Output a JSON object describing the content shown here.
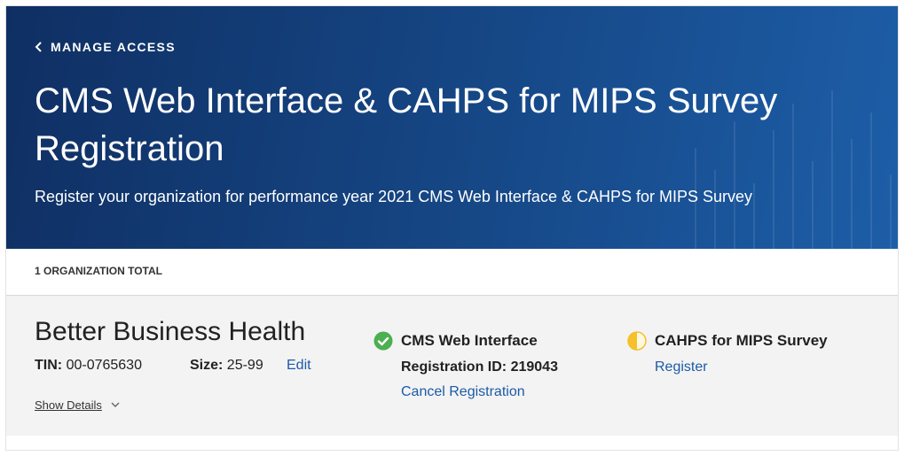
{
  "header": {
    "back_label": "MANAGE ACCESS",
    "title": "CMS Web Interface & CAHPS for MIPS Survey Registration",
    "subtitle": "Register your organization for performance year 2021 CMS Web Interface & CAHPS for MIPS Survey"
  },
  "summary": {
    "count_label": "1 ORGANIZATION TOTAL"
  },
  "organization": {
    "name": "Better Business Health",
    "tin_label": "TIN:",
    "tin_value": "00-0765630",
    "size_label": "Size:",
    "size_value": "25-99",
    "edit_label": "Edit",
    "show_details_label": "Show Details",
    "web_interface": {
      "title": "CMS Web Interface",
      "status_icon": "check-circle-icon",
      "status_color": "#4caf50",
      "registration_label": "Registration ID:",
      "registration_id": "219043",
      "action_label": "Cancel Registration"
    },
    "cahps": {
      "title": "CAHPS for MIPS Survey",
      "status_icon": "half-circle-icon",
      "status_color": "#f5c02b",
      "action_label": "Register"
    }
  },
  "colors": {
    "hero_dark": "#0f2f63",
    "hero_light": "#1d5ea8",
    "link": "#1c5aa6",
    "panel": "#f3f3f3"
  }
}
